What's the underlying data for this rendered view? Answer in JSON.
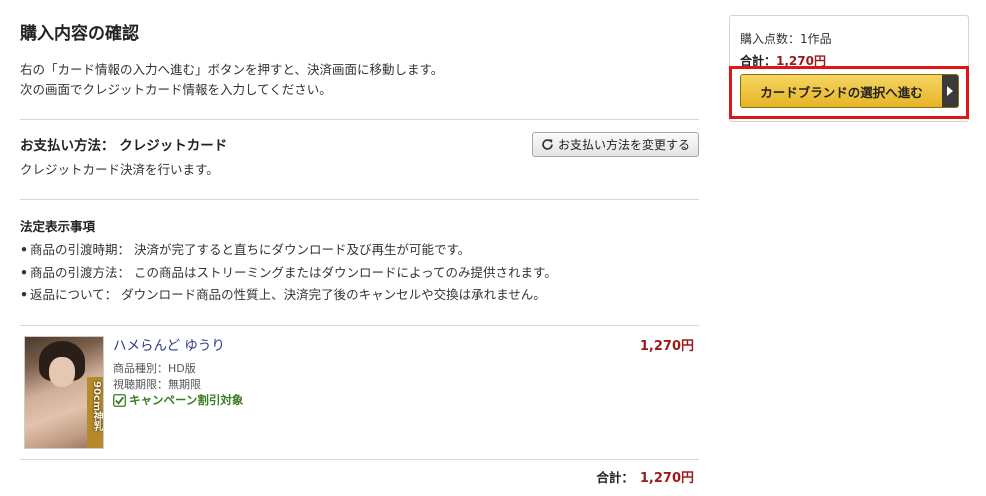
{
  "page": {
    "title": "購入内容の確認",
    "intro_lines": [
      "右の「カード情報の入力へ進む」ボタンを押すと、決済画面に移動します。",
      "次の画面でクレジットカード情報を入力してください。"
    ]
  },
  "payment": {
    "label": "お支払い方法： クレジットカード",
    "description": "クレジットカード決済を行います。",
    "change_button": "お支払い方法を変更する",
    "change_icon": "refresh-icon"
  },
  "legal": {
    "title": "法定表示事項",
    "bullet": "•",
    "items": [
      "商品の引渡時期： 決済が完了すると直ちにダウンロード及び再生が可能です。",
      "商品の引渡方法： この商品はストリーミングまたはダウンロードによってのみ提供されます。",
      "返品について： ダウンロード商品の性質上、決済完了後のキャンセルや交換は承れません。"
    ]
  },
  "item": {
    "title": "ハメらんど ゆうり",
    "price": "1,270円",
    "type": "商品種別：HD版",
    "period": "視聴期限：無期限",
    "campaign": "キャンペーン割引対象",
    "campaign_icon": "checkbox-checked-icon",
    "thumbnail_text": "90cm神乳"
  },
  "total": {
    "label": "合計：",
    "value": "1,270円"
  },
  "sidebar": {
    "count": "購入点数：1作品",
    "total_label": "合計：",
    "total_value": "1,270円",
    "proceed_button": "カードブランドの選択へ進む",
    "highlight_color": "#e01616"
  },
  "colors": {
    "price": "#9b1b1b",
    "link": "#2b3a8c",
    "campaign": "#3a7d22",
    "button_gold": "#e6b525"
  }
}
